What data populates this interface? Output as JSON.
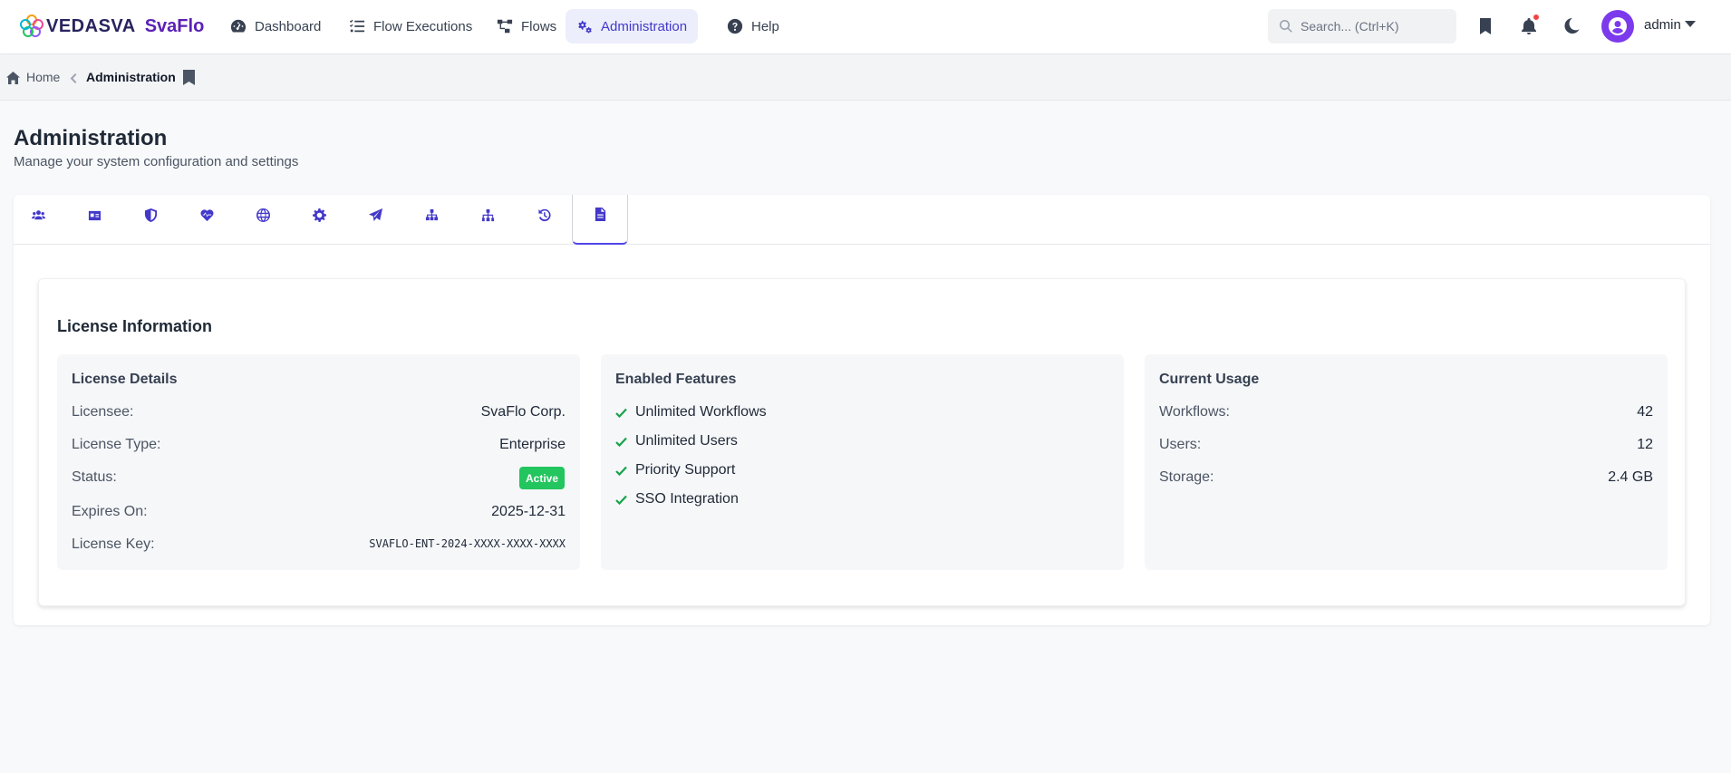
{
  "brand": {
    "name": "VEDASVA",
    "product": "SvaFlo"
  },
  "nav": {
    "items": [
      {
        "label": "Dashboard",
        "icon": "gauge-icon"
      },
      {
        "label": "Flow Executions",
        "icon": "list-check-icon"
      },
      {
        "label": "Flows",
        "icon": "flow-diagram-icon"
      },
      {
        "label": "Administration",
        "icon": "gears-icon",
        "active": true
      },
      {
        "label": "Help",
        "icon": "question-circle-icon"
      }
    ],
    "search_placeholder": "Search... (Ctrl+K)",
    "user": "admin"
  },
  "breadcrumb": {
    "home": "Home",
    "current": "Administration"
  },
  "page": {
    "title": "Administration",
    "subtitle": "Manage your system configuration and settings"
  },
  "tabs": [
    {
      "icon": "users-icon"
    },
    {
      "icon": "id-card-icon"
    },
    {
      "icon": "shield-icon"
    },
    {
      "icon": "heart-pulse-icon"
    },
    {
      "icon": "globe-icon"
    },
    {
      "icon": "gear-icon"
    },
    {
      "icon": "paper-plane-icon"
    },
    {
      "icon": "sitemap-icon"
    },
    {
      "icon": "hierarchy-icon"
    },
    {
      "icon": "history-icon"
    },
    {
      "icon": "file-icon",
      "active": true
    }
  ],
  "license": {
    "section_title": "License Information",
    "details": {
      "title": "License Details",
      "licensee_label": "Licensee:",
      "licensee": "SvaFlo Corp.",
      "type_label": "License Type:",
      "type": "Enterprise",
      "status_label": "Status:",
      "status": "Active",
      "expires_label": "Expires On:",
      "expires": "2025-12-31",
      "key_label": "License Key:",
      "key": "SVAFLO-ENT-2024-XXXX-XXXX-XXXX"
    },
    "features": {
      "title": "Enabled Features",
      "items": [
        "Unlimited Workflows",
        "Unlimited Users",
        "Priority Support",
        "SSO Integration"
      ]
    },
    "usage": {
      "title": "Current Usage",
      "workflows_label": "Workflows:",
      "workflows": "42",
      "users_label": "Users:",
      "users": "12",
      "storage_label": "Storage:",
      "storage": "2.4 GB"
    }
  },
  "colors": {
    "accent": "#4338ca",
    "brand_product": "#5b21b6",
    "badge_active": "#22c55e",
    "notification": "#ef4444",
    "avatar": "#7c3aed"
  }
}
